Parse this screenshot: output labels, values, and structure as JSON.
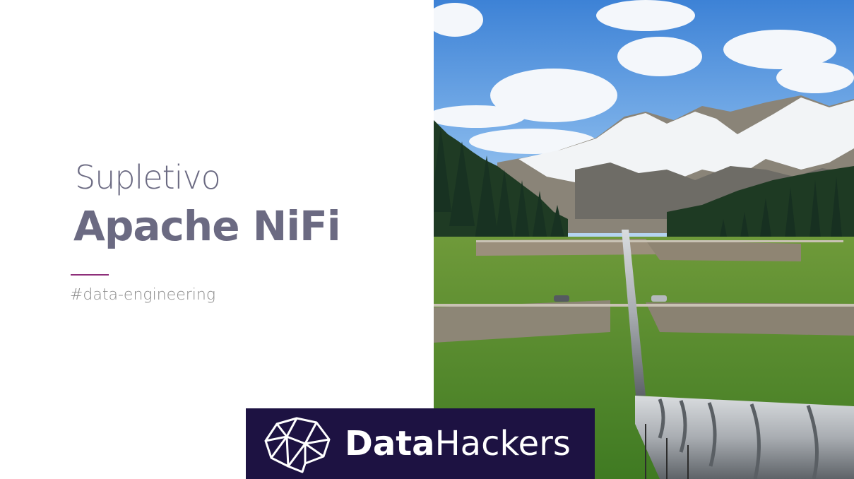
{
  "slide": {
    "subtitle": "Supletivo",
    "title": "Apache NiFi",
    "tag": "#data-engineering"
  },
  "logo": {
    "name_part1": "Data",
    "name_part2": "Hackers",
    "icon": "brain-network-icon"
  },
  "colors": {
    "text": "#6b6a82",
    "accent": "#8e2f7a",
    "tag": "#8a8a8a",
    "banner": "#1d1242"
  }
}
